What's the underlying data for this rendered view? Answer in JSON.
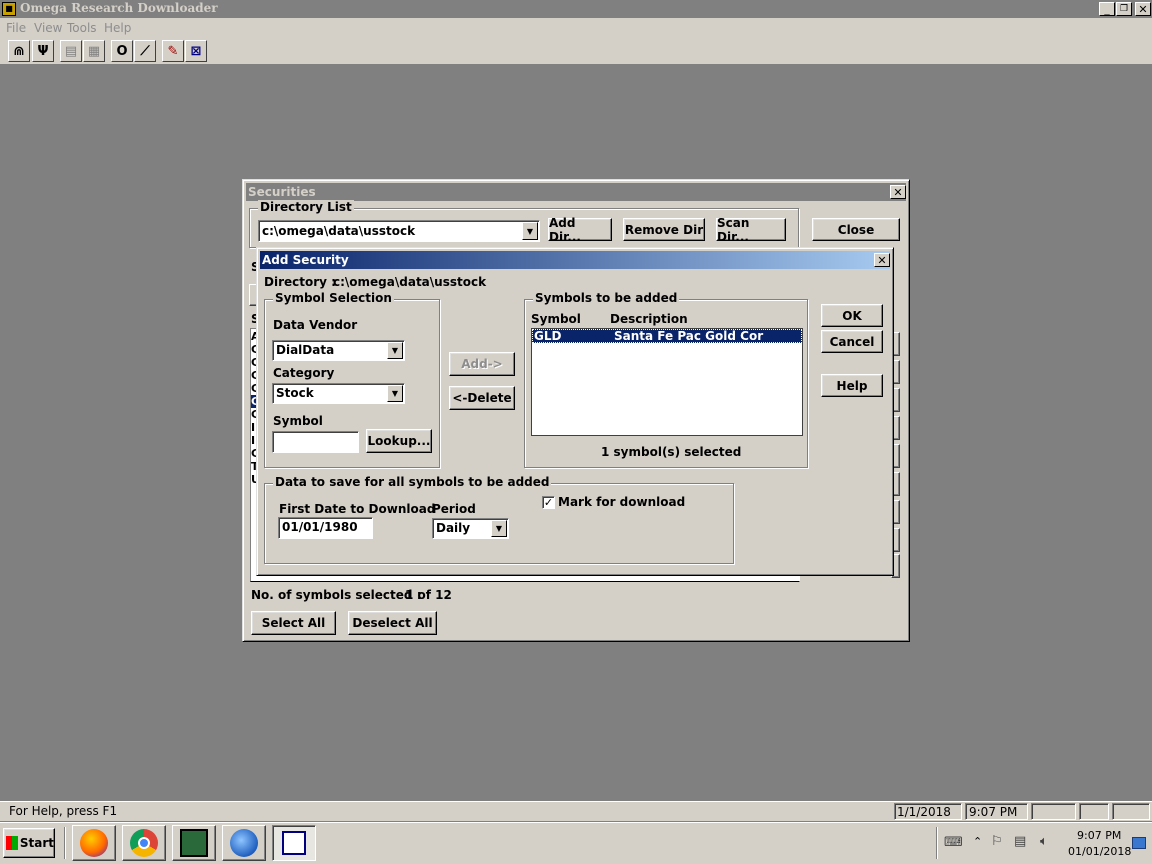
{
  "app": {
    "title": "Omega Research Downloader",
    "menu": [
      "File",
      "View",
      "Tools",
      "Help"
    ]
  },
  "toolbar": {
    "icons": [
      "magnet-icon",
      "filter-icon",
      "save-icon",
      "print-icon",
      "circle-icon",
      "link-icon",
      "tools-icon",
      "grid-icon"
    ]
  },
  "securities": {
    "title": "Securities",
    "directory_group": "Directory List",
    "directory_value": "c:\\omega\\data\\usstock",
    "add_dir": "Add Dir...",
    "remove_dir": "Remove Dir",
    "scan_dir": "Scan Dir...",
    "close": "Close",
    "partial_s1": "S",
    "partial_s2": "S",
    "left_letters": [
      "A",
      "C",
      "C",
      "C",
      "G",
      "G",
      "G",
      "I",
      "I",
      "G",
      "T",
      "U"
    ],
    "count_label": "No. of symbols selected :",
    "count_value": "1 of 12",
    "select_all": "Select All",
    "deselect_all": "Deselect All"
  },
  "add_security": {
    "title": "Add Security",
    "directory_label": "Directory :",
    "directory_value": "c:\\omega\\data\\usstock",
    "symbol_selection": "Symbol Selection",
    "data_vendor_label": "Data Vendor",
    "data_vendor_value": "DialData",
    "category_label": "Category",
    "category_value": "Stock",
    "symbol_label": "Symbol",
    "symbol_value": "",
    "lookup": "Lookup...",
    "add": "Add->",
    "delete": "<-Delete",
    "symbols_group": "Symbols to be added",
    "col_symbol": "Symbol",
    "col_description": "Description",
    "rows": [
      {
        "symbol": "GLD",
        "description": "Santa Fe Pac Gold Cor"
      }
    ],
    "selected_text": "1 symbol(s) selected",
    "ok": "OK",
    "cancel": "Cancel",
    "help": "Help",
    "data_group": "Data to save for all symbols to be added",
    "first_date_label": "First Date to Download",
    "first_date_value": "01/01/1980",
    "period_label": "Period",
    "period_value": "Daily",
    "mark_label": "Mark for download",
    "mark_checked": true
  },
  "statusbar": {
    "help": "For Help, press F1",
    "date": "1/1/2018",
    "time": "9:07 PM"
  },
  "taskbar": {
    "start": "Start",
    "clock_time": "9:07 PM",
    "clock_date": "01/01/2018"
  },
  "colors": {
    "desktop": "#808080",
    "face": "#d4d0c8",
    "title_active_start": "#0a246a",
    "title_active_end": "#a6caf0",
    "title_inactive": "#808080",
    "selection": "#0a246a"
  }
}
